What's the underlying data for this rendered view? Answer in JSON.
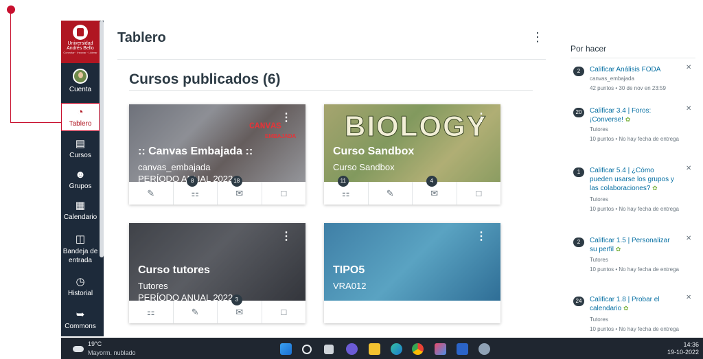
{
  "nav": {
    "logo_name": "Universidad Andrés Bello",
    "logo_tagline": "Conectar · Innovar · Liderar",
    "items": [
      {
        "label": "Cuenta",
        "icon": "avatar"
      },
      {
        "label": "Tablero",
        "icon": "dashboard-icon"
      },
      {
        "label": "Cursos",
        "icon": "courses-icon"
      },
      {
        "label": "Grupos",
        "icon": "groups-icon"
      },
      {
        "label": "Calendario",
        "icon": "calendar-icon"
      },
      {
        "label": "Bandeja de entrada",
        "icon": "inbox-icon"
      },
      {
        "label": "Historial",
        "icon": "clock-icon"
      },
      {
        "label": "Commons",
        "icon": "commons-icon"
      }
    ]
  },
  "main": {
    "title": "Tablero",
    "section_title": "Cursos publicados (6)",
    "cards": [
      {
        "title": ":: Canvas Embajada ::",
        "code": "canvas_embajada",
        "term": "PERÍODO ANUAL 2022",
        "brand": "CANVAS",
        "brand_sub": "EMBAJADA",
        "badges": [
          "",
          "8",
          "18",
          ""
        ]
      },
      {
        "title": "Curso Sandbox",
        "code": "Curso Sandbox",
        "term": "",
        "brand": "BIOLOGY",
        "badges": [
          "11",
          "",
          "4",
          ""
        ]
      },
      {
        "title": "Curso tutores",
        "code": "Tutores",
        "term": "PERÍODO ANUAL 2022",
        "badges": [
          "",
          "",
          "3",
          ""
        ]
      },
      {
        "title": "TIPO5",
        "code": "VRA012",
        "term": "",
        "badges": []
      }
    ]
  },
  "todo": {
    "title": "Por hacer",
    "items": [
      {
        "count": "2",
        "title": "Calificar Análisis FODA",
        "course": "canvas_embajada",
        "details": "42 puntos • 30 de nov en 23:59",
        "leaf": false
      },
      {
        "count": "20",
        "title": "Calificar 3.4 | Foros: ¡Converse!",
        "course": "Tutores",
        "details": "10 puntos • No hay fecha de entrega",
        "leaf": true
      },
      {
        "count": "1",
        "title": "Calificar 5.4 | ¿Cómo pueden usarse los grupos y las colaboraciones?",
        "course": "Tutores",
        "details": "10 puntos • No hay fecha de entrega",
        "leaf": true
      },
      {
        "count": "2",
        "title": "Calificar 1.5 | Personalizar su perfil",
        "course": "Tutores",
        "details": "10 puntos • No hay fecha de entrega",
        "leaf": true
      },
      {
        "count": "24",
        "title": "Calificar 1.8 | Probar el calendario",
        "course": "Tutores",
        "details": "10 puntos • No hay fecha de entrega",
        "leaf": true
      }
    ]
  },
  "taskbar": {
    "temperature": "19°C",
    "condition": "Mayorm. nublado",
    "time": "14:36",
    "date": "19-10-2022"
  },
  "colors": {
    "brand": "#b01622",
    "nav_bg": "#1d2a3a",
    "link": "#0770a3",
    "annotation": "#c8102e"
  }
}
